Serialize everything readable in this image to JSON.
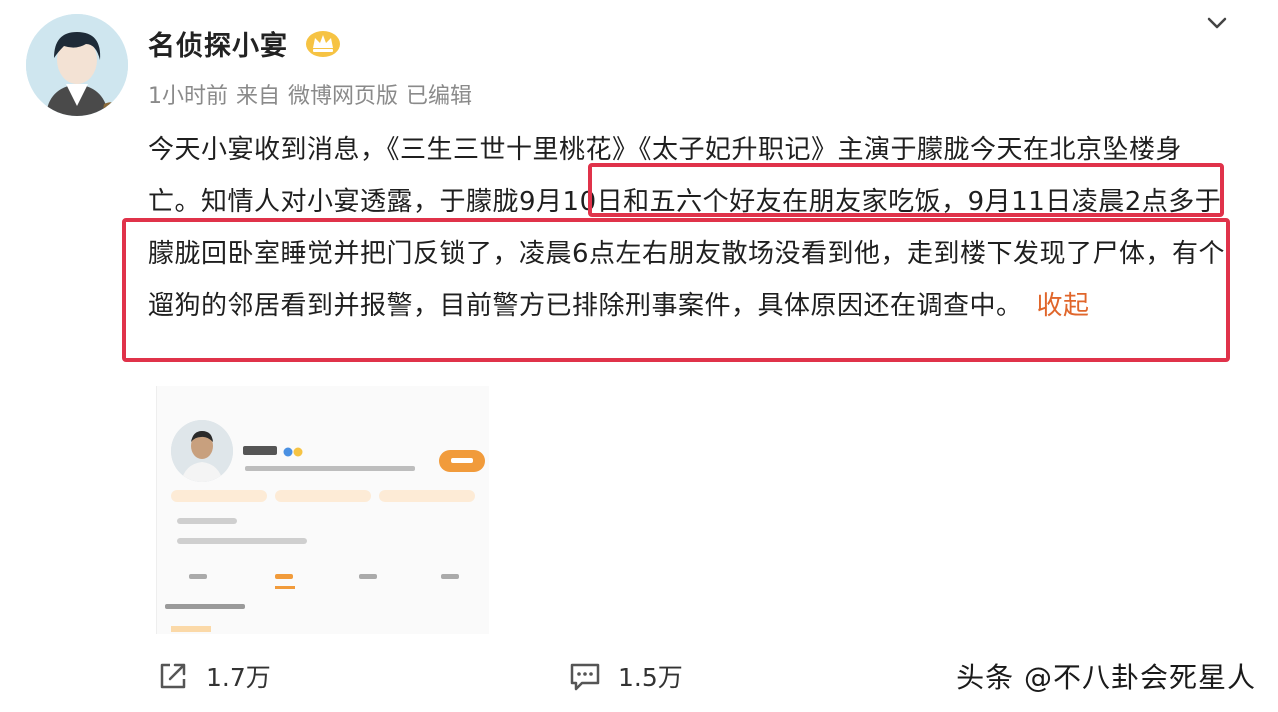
{
  "post": {
    "author": "名侦探小宴",
    "meta": [
      "1小时前",
      "来自",
      "微博网页版",
      "已编辑"
    ],
    "body": "今天小宴收到消息，《三生三世十里桃花》《太子妃升职记》主演于朦胧今天在北京坠楼身亡。知情人对小宴透露，于朦胧9月10日和五六个好友在朋友家吃饭，9月11日凌晨2点多于朦胧回卧室睡觉并把门反锁了，凌晨6点左右朋友散场没看到他，走到楼下发现了尸体，有个遛狗的邻居看到并报警，目前警方已排除刑事案件，具体原因还在调查中。",
    "collapse_label": "收起"
  },
  "footer": {
    "share_count": "1.7万",
    "comment_count": "1.5万"
  },
  "watermark": "头条 @不八卦会死星人",
  "colors": {
    "highlight": "#e0324a",
    "link": "#e0662b"
  }
}
